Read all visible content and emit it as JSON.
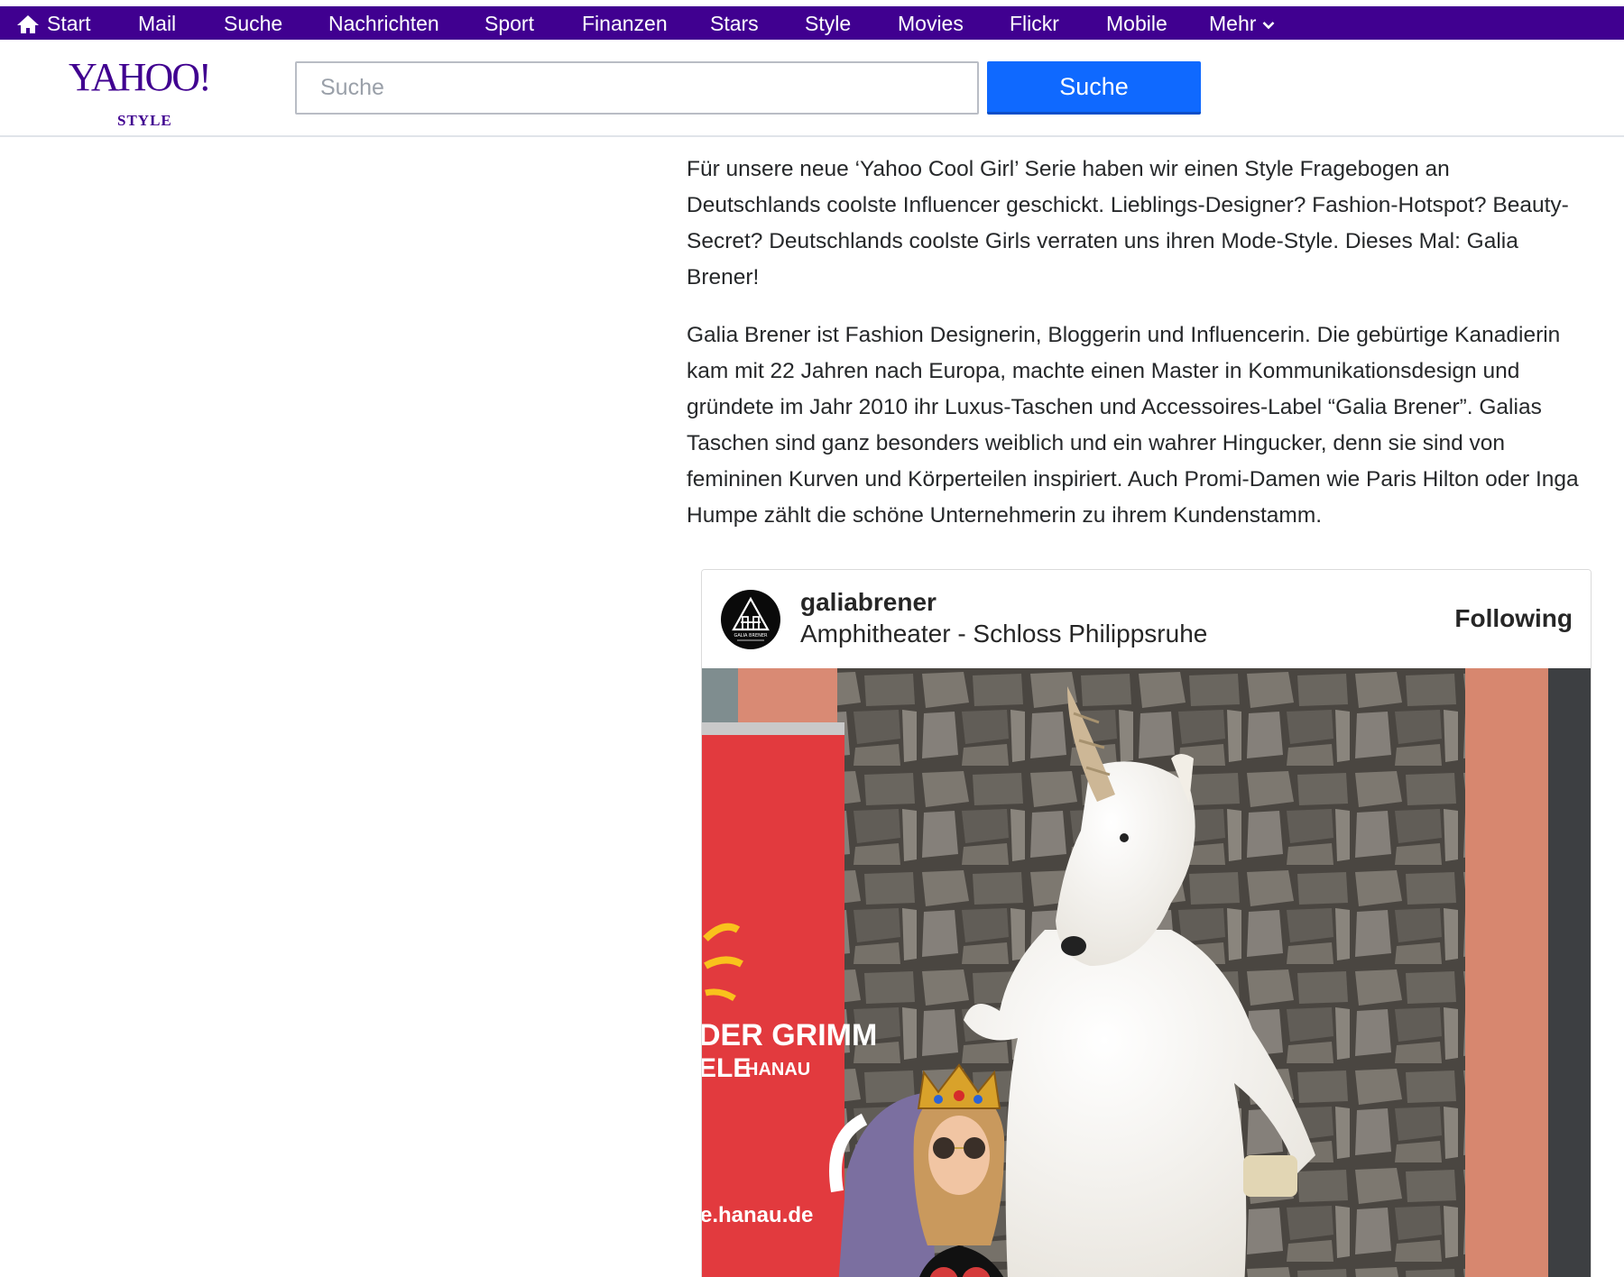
{
  "nav": {
    "items": [
      {
        "label": "Start",
        "icon": "home-icon"
      },
      {
        "label": "Mail"
      },
      {
        "label": "Suche"
      },
      {
        "label": "Nachrichten"
      },
      {
        "label": "Sport"
      },
      {
        "label": "Finanzen"
      },
      {
        "label": "Stars"
      },
      {
        "label": "Style"
      },
      {
        "label": "Movies"
      },
      {
        "label": "Flickr"
      },
      {
        "label": "Mobile"
      },
      {
        "label": "Mehr",
        "icon": "chevron-down-icon"
      }
    ],
    "background_color": "#400090"
  },
  "header": {
    "logo": {
      "wordmark": "YAHOO!",
      "sub": "STYLE",
      "color": "#400090"
    },
    "search": {
      "placeholder": "Suche",
      "value": ""
    },
    "search_button": {
      "label": "Suche",
      "color": "#0f69ff"
    }
  },
  "article": {
    "paragraphs": [
      "Für unsere neue ‘Yahoo Cool Girl’ Serie haben wir einen Style Fragebogen an Deutschlands coolste Influencer geschickt. Lieblings-Designer? Fashion-Hotspot? Beauty-Secret? Deutschlands coolste Girls verraten uns ihren Mode-Style. Dieses Mal: Galia Brener!",
      "Galia Brener ist Fashion Designerin, Bloggerin und Influencerin. Die gebürtige Kanadierin kam mit 22 Jahren nach Europa, machte einen Master in Kommunikationsdesign und gründete im Jahr 2010 ihr Luxus-Taschen und Accessoires-Label “Galia Brener”. Galias Taschen sind ganz besonders weiblich und ein wahrer Hingucker, denn sie sind von femininen Kurven und Körperteilen inspiriert.  Auch Promi-Damen wie Paris Hilton oder Inga Humpe zählt die schöne Unternehmerin zu ihrem Kundenstamm."
    ]
  },
  "instagram": {
    "username": "galiabrener",
    "location": "Amphitheater - Schloss Philippsruhe",
    "follow_label": "Following",
    "avatar_text": "GALIA BRENER",
    "photo": {
      "banner_line1": "DER GRIMM",
      "banner_line2": "ELE",
      "banner_line2b": "HANAU",
      "banner_url": "e.hanau.de"
    }
  }
}
